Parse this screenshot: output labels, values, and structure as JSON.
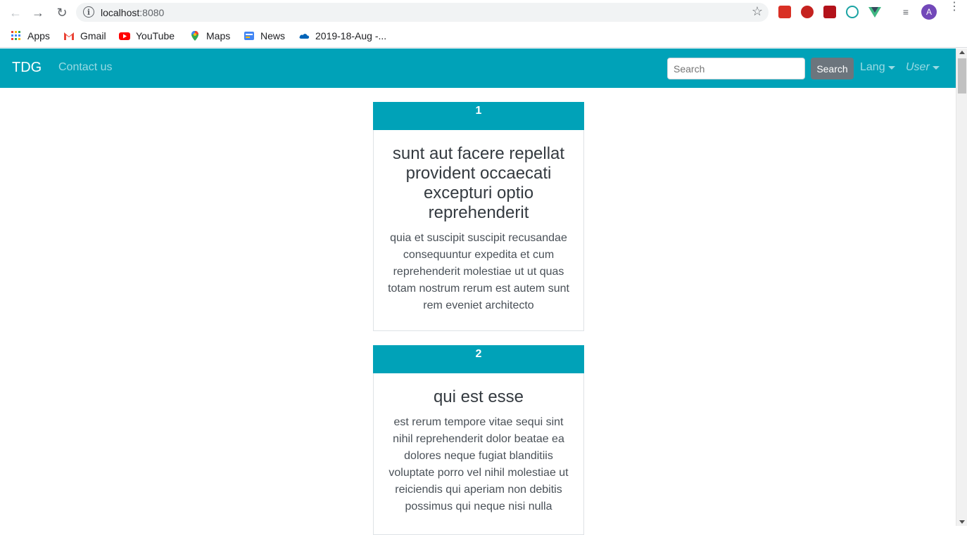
{
  "browser": {
    "url_host": "localhost",
    "url_port": ":8080",
    "avatar_letter": "A",
    "bookmarks": [
      {
        "label": "Apps"
      },
      {
        "label": "Gmail"
      },
      {
        "label": "YouTube"
      },
      {
        "label": "Maps"
      },
      {
        "label": "News"
      },
      {
        "label": "2019-18-Aug -..."
      }
    ]
  },
  "navbar": {
    "brand": "TDG",
    "contact_link": "Contact us",
    "search_placeholder": "Search",
    "search_button": "Search",
    "lang_dropdown": "Lang",
    "user_dropdown": "User",
    "color": "#00a2b8"
  },
  "posts": [
    {
      "id": "1",
      "title": "sunt aut facere repellat provident occaecati excepturi optio reprehenderit",
      "body": "quia et suscipit suscipit recusandae consequuntur expedita et cum reprehenderit molestiae ut ut quas totam nostrum rerum est autem sunt rem eveniet architecto"
    },
    {
      "id": "2",
      "title": "qui est esse",
      "body": "est rerum tempore vitae sequi sint nihil reprehenderit dolor beatae ea dolores neque fugiat blanditiis voluptate porro vel nihil molestiae ut reiciendis qui aperiam non debitis possimus qui neque nisi nulla"
    }
  ]
}
